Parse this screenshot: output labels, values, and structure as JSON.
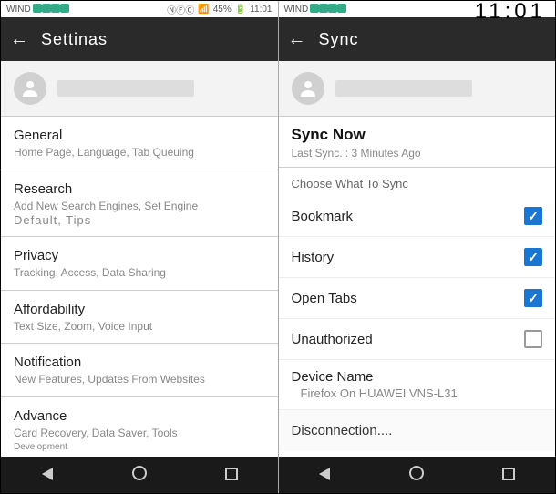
{
  "status": {
    "carrier_left": "WIND",
    "time_left": "11:01",
    "battery_left": "45%",
    "carrier_right": "WIND",
    "clock_right": "11:01"
  },
  "left": {
    "header": "Settinas",
    "sections": [
      {
        "title": "General",
        "sub": "Home Page, Language, Tab Queuing"
      },
      {
        "title": "Research",
        "sub": "Add New Search Engines, Set Engine",
        "sub2": "Default, Tips"
      },
      {
        "title": "Privacy",
        "sub": "Tracking, Access, Data Sharing"
      },
      {
        "title": "Affordability",
        "sub": "Text Size, Zoom, Voice Input"
      },
      {
        "title": "Notification",
        "sub": "New Features, Updates From Websites"
      },
      {
        "title": "Advance",
        "sub": "Card Recovery, Data Saver, Tools",
        "sub2": "Development"
      }
    ]
  },
  "right": {
    "header": "Sync",
    "sync_now": "Sync Now",
    "last_sync": "Last Sync. : 3 Minutes Ago",
    "choose": "Choose What To Sync",
    "items": [
      {
        "label": "Bookmark",
        "checked": true
      },
      {
        "label": "History",
        "checked": true
      },
      {
        "label": "Open Tabs",
        "checked": true
      },
      {
        "label": "Unauthorized",
        "checked": false
      }
    ],
    "device_label": "Device Name",
    "device_value": "Firefox On HUAWEI VNS-L31",
    "disconnect": "Disconnection...."
  }
}
